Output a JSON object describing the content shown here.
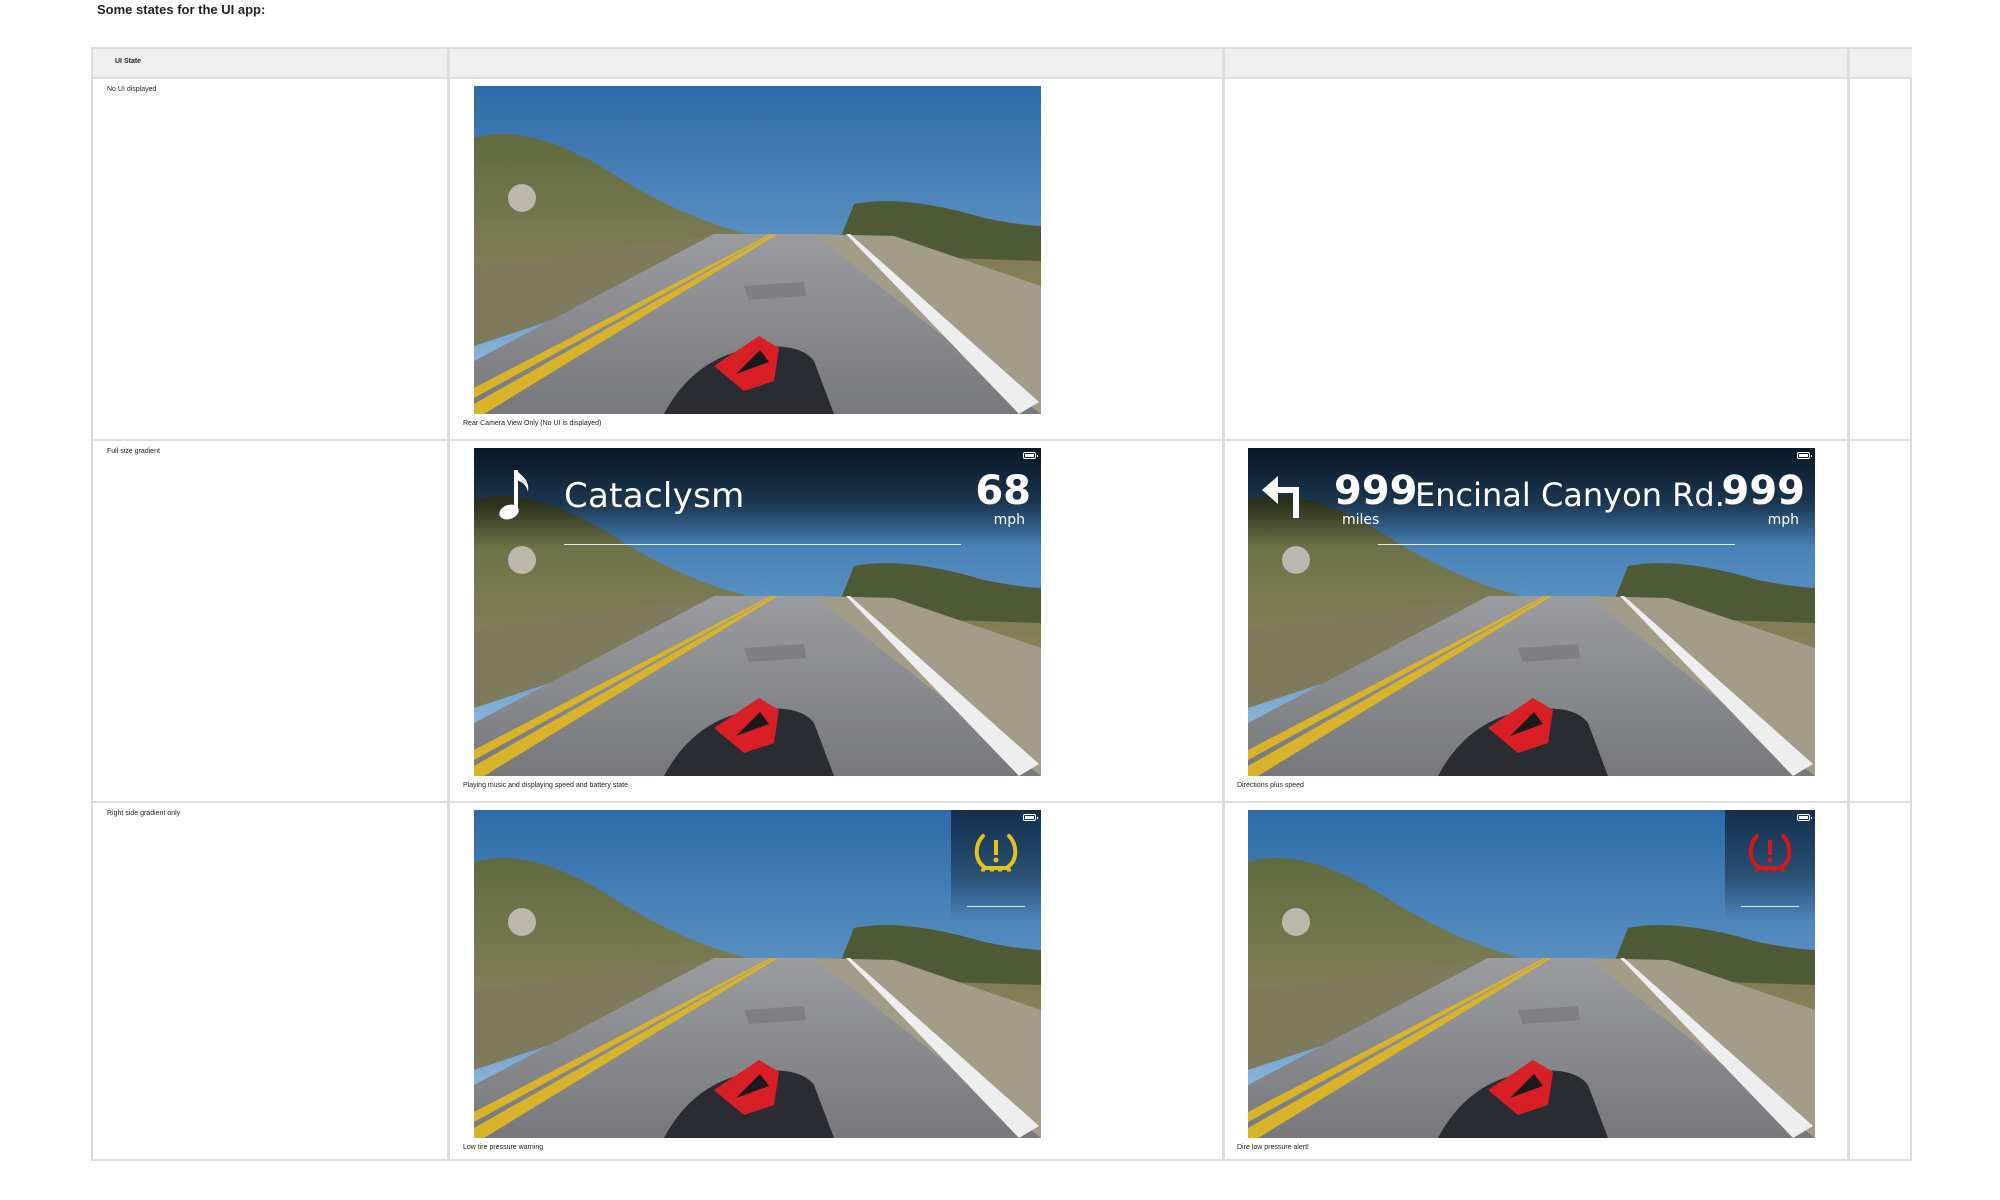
{
  "page": {
    "heading": "Some states for the UI app:"
  },
  "table": {
    "header": {
      "col1": "UI State",
      "col2": "",
      "col3": "",
      "col4": ""
    },
    "rows": [
      {
        "label": "No UI displayed",
        "cells": [
          {
            "caption": "Rear Camera View Only (No UI is displayed)",
            "overlay": "none"
          },
          {
            "caption": "",
            "overlay": "empty"
          }
        ]
      },
      {
        "label": "Full size gradient",
        "cells": [
          {
            "caption": "Playing music and displaying speed and battery state",
            "overlay": "music",
            "song_title": "Cataclysm",
            "speed": "68",
            "speed_unit": "mph",
            "icon": "music-note-icon"
          },
          {
            "caption": "Directions plus speed",
            "overlay": "directions",
            "distance": "999",
            "distance_unit": "miles",
            "street": "Encinal Canyon Rd.",
            "speed": "999",
            "speed_unit": "mph",
            "icon": "turn-left-arrow-icon"
          }
        ]
      },
      {
        "label": "Right side gradient only",
        "cells": [
          {
            "caption": "Low tire pressure warning",
            "overlay": "warning",
            "icon": "tire-pressure-warning-icon",
            "icon_color": "#e3c21c"
          },
          {
            "caption": "Dire low pressure alert!",
            "overlay": "alert",
            "icon": "tire-pressure-alert-icon",
            "icon_color": "#d6171a"
          }
        ]
      }
    ]
  },
  "colors": {
    "sky_top": "#2f6fad",
    "sky_bottom": "#8cb9d9",
    "road": "#8a8a8e",
    "lane_yellow": "#d9b42a",
    "warning": "#e3c21c",
    "alert": "#d6171a"
  }
}
